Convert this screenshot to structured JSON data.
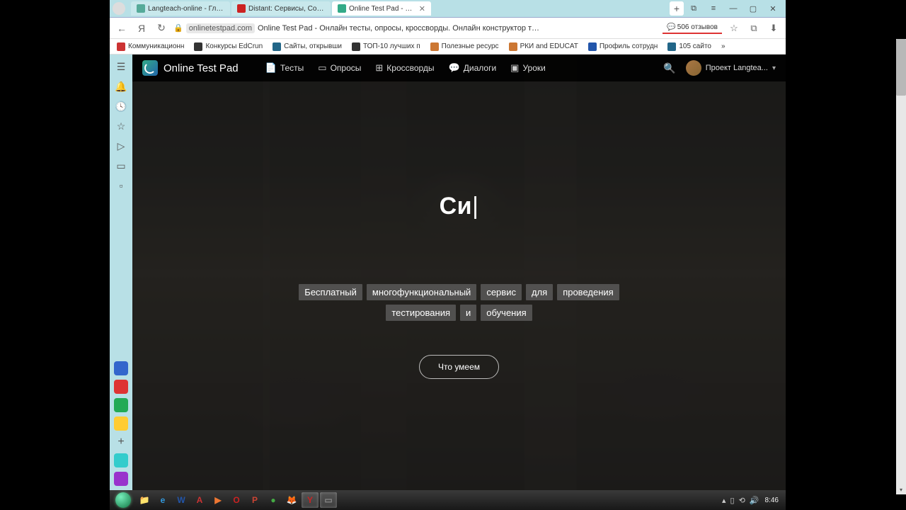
{
  "browser": {
    "tabs": [
      {
        "label": "Langteach-online - Главна",
        "favicon": "#5a9"
      },
      {
        "label": "Distant: Сервисы, Советы",
        "favicon": "#c22"
      },
      {
        "label": "Online Test Pad - Онла",
        "favicon": "#3a8",
        "active": true
      }
    ],
    "window_controls": {
      "sidebar": "⧉",
      "menu": "≡",
      "min": "—",
      "max": "▢",
      "close": "✕"
    },
    "nav": {
      "back": "←",
      "ya": "Я",
      "reload": "↻"
    },
    "address": {
      "lock": "🔒",
      "domain": "onlinetestpad.com",
      "title": "Online Test Pad - Онлайн тесты, опросы, кроссворды. Онлайн конструктор тесто..."
    },
    "reviews": "506 отзывов",
    "toolbar_icons": {
      "bookmark": "☆",
      "ext": "⧉",
      "download": "⬇"
    },
    "bookmarks": [
      {
        "label": "Коммуникационн",
        "color": "#c33"
      },
      {
        "label": "Конкурсы EdCrun",
        "color": "#333"
      },
      {
        "label": "Сайты, открывши",
        "color": "#268"
      },
      {
        "label": "ТОП-10 лучших п",
        "color": "#333"
      },
      {
        "label": "Полезные ресурс",
        "color": "#c73"
      },
      {
        "label": "РКИ and EDUCAT",
        "color": "#c73"
      },
      {
        "label": "Профиль сотрудн",
        "color": "#25a"
      },
      {
        "label": "105 сайто",
        "color": "#268"
      }
    ],
    "sidebar_icons": [
      "☰",
      "🔔",
      "🕓",
      "☆",
      "▷",
      "▭",
      "▫"
    ],
    "sidebar_bottom": [
      {
        "c": "#36c"
      },
      {
        "c": "#d33"
      },
      {
        "c": "#2a5"
      },
      {
        "c": "#fc3"
      },
      {
        "text": "+",
        "c": "transparent"
      },
      {
        "c": "#3cc"
      },
      {
        "c": "#93c"
      }
    ]
  },
  "page": {
    "brand": "Online Test Pad",
    "nav": [
      {
        "icon": "📄",
        "label": "Тесты"
      },
      {
        "icon": "▭",
        "label": "Опросы"
      },
      {
        "icon": "⊞",
        "label": "Кроссворды"
      },
      {
        "icon": "💬",
        "label": "Диалоги"
      },
      {
        "icon": "▣",
        "label": "Уроки"
      }
    ],
    "user": "Проект Langtea...",
    "hero_title": "Си",
    "tagline": [
      "Бесплатный",
      "многофункциональный",
      "сервис",
      "для",
      "проведения",
      "тестирования",
      "и",
      "обучения"
    ],
    "cta": "Что умеем"
  },
  "taskbar": {
    "apps": [
      {
        "c": "#fc3",
        "ch": "📁"
      },
      {
        "c": "#39d",
        "ch": "e"
      },
      {
        "c": "#25a",
        "ch": "W"
      },
      {
        "c": "#c33",
        "ch": "A"
      },
      {
        "c": "#e73",
        "ch": "▶"
      },
      {
        "c": "#c22",
        "ch": "O"
      },
      {
        "c": "#c43",
        "ch": "P"
      },
      {
        "c": "#4a4",
        "ch": "●"
      },
      {
        "c": "#e63",
        "ch": "🦊"
      },
      {
        "c": "#c22",
        "ch": "Y",
        "active": true
      },
      {
        "c": "#888",
        "ch": "▭",
        "active": true
      }
    ],
    "tray": [
      "▴",
      "▯",
      "⟲",
      "🔊"
    ],
    "clock": "8:46"
  }
}
